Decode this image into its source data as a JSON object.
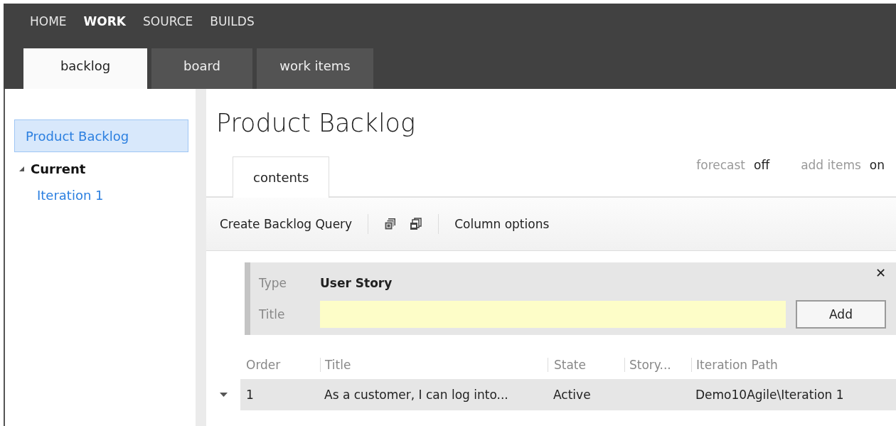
{
  "nav": [
    {
      "label": "HOME",
      "selected": false
    },
    {
      "label": "WORK",
      "selected": true
    },
    {
      "label": "SOURCE",
      "selected": false
    },
    {
      "label": "BUILDS",
      "selected": false
    }
  ],
  "tabs": [
    {
      "label": "backlog",
      "selected": true
    },
    {
      "label": "board",
      "selected": false
    },
    {
      "label": "work items",
      "selected": false
    }
  ],
  "sidebar": {
    "items": [
      {
        "label": "Product Backlog",
        "selected": true
      },
      {
        "label": "Current",
        "selected": false,
        "expanded": true,
        "children": [
          {
            "label": "Iteration 1",
            "selected": false
          }
        ]
      }
    ]
  },
  "page_title": "Product Backlog",
  "subtabs": [
    {
      "label": "contents",
      "selected": true
    }
  ],
  "settings": [
    {
      "label": "forecast",
      "value": "off"
    },
    {
      "label": "add items",
      "value": "on"
    }
  ],
  "toolbar": {
    "create_query": "Create Backlog Query",
    "column_options": "Column options"
  },
  "add_panel": {
    "type_label": "Type",
    "type_value": "User Story",
    "title_label": "Title",
    "close": "✕",
    "add_button": "Add"
  },
  "table": {
    "columns": [
      "Order",
      "Title",
      "State",
      "Story...",
      "Iteration Path"
    ],
    "rows": [
      {
        "expanded": true,
        "cells": [
          "1",
          "As a customer, I can log into...",
          "Active",
          "",
          "Demo10Agile\\Iteration 1"
        ]
      }
    ]
  }
}
